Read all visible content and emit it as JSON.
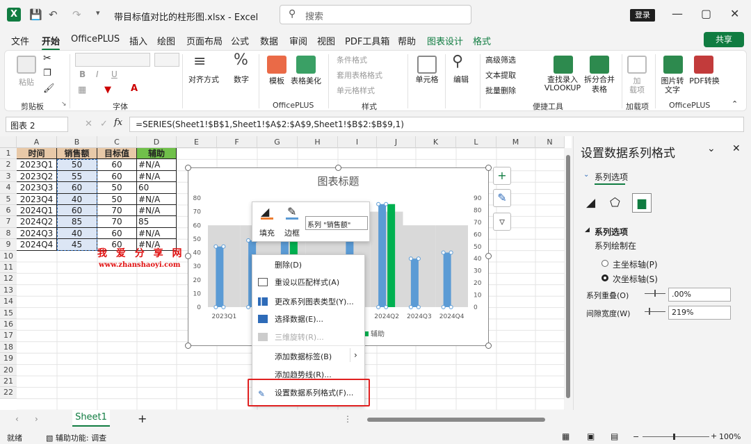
{
  "window": {
    "title": "带目标值对比的柱形图.xlsx  -  Excel",
    "search_placeholder": "搜索",
    "login_label": "登录",
    "share_label": "共享"
  },
  "menu": {
    "tabs": [
      "文件",
      "开始",
      "OfficePLUS",
      "插入",
      "绘图",
      "页面布局",
      "公式",
      "数据",
      "审阅",
      "视图",
      "PDF工具箱",
      "帮助",
      "图表设计",
      "格式"
    ],
    "active": "开始"
  },
  "ribbon": {
    "clipboard": {
      "paste": "粘贴",
      "group": "剪贴板"
    },
    "font": {
      "group": "字体",
      "bold": "B",
      "italic": "I",
      "underline": "U"
    },
    "align": {
      "label": "对齐方式"
    },
    "number": {
      "label": "数字",
      "symbol": "%"
    },
    "officeplus": {
      "template": "模板",
      "beautify": "表格美化",
      "group": "OfficePLUS"
    },
    "styles": {
      "conditional": "条件格式",
      "table_format": "套用表格格式",
      "cell_style": "单元格样式",
      "group": "样式"
    },
    "cells": {
      "label": "单元格"
    },
    "editing": {
      "label": "编辑"
    },
    "tools": {
      "filter": "高级筛选",
      "extract": "文本提取",
      "batch_delete": "批量删除",
      "lookup": "查找录入\nVLOOKUP",
      "lookup1": "查找录入",
      "lookup2": "VLOOKUP",
      "split1": "拆分合并",
      "split2": "表格",
      "group": "便捷工具"
    },
    "addins": {
      "label1": "加",
      "label2": "载项",
      "group": "加载项"
    },
    "pdf": {
      "img2txt1": "图片转",
      "img2txt2": "文字",
      "pdf_convert": "PDF转换",
      "group": "OfficePLUS"
    }
  },
  "formula_bar": {
    "name_box": "图表 2",
    "fx": "fx",
    "formula": "=SERIES(Sheet1!$B$1,Sheet1!$A$2:$A$9,Sheet1!$B$2:$B$9,1)"
  },
  "sheet": {
    "columns": [
      "A",
      "B",
      "C",
      "D",
      "E",
      "F",
      "G",
      "H",
      "I",
      "J",
      "K",
      "L",
      "M",
      "N"
    ],
    "rows": [
      "1",
      "2",
      "3",
      "4",
      "5",
      "6",
      "7",
      "8",
      "9",
      "10",
      "11",
      "12",
      "13",
      "14",
      "15",
      "16",
      "17",
      "18",
      "19",
      "20",
      "21",
      "22"
    ],
    "headers": [
      "时间",
      "销售额",
      "目标值",
      "辅助"
    ],
    "data": [
      [
        "2023Q1",
        "50",
        "60",
        "#N/A"
      ],
      [
        "2023Q2",
        "55",
        "60",
        "#N/A"
      ],
      [
        "2023Q3",
        "60",
        "50",
        "60"
      ],
      [
        "2023Q4",
        "40",
        "50",
        "#N/A"
      ],
      [
        "2024Q1",
        "60",
        "70",
        "#N/A"
      ],
      [
        "2024Q2",
        "85",
        "70",
        "85"
      ],
      [
        "2024Q3",
        "40",
        "60",
        "#N/A"
      ],
      [
        "2024Q4",
        "45",
        "60",
        "#N/A"
      ]
    ],
    "watermark1": "我 爱 分 享 网",
    "watermark2": "www.zhanshaoyi.com",
    "tab_name": "Sheet1",
    "add_sheet": "+"
  },
  "chart_data": {
    "type": "bar",
    "title": "图表标题",
    "categories": [
      "2023Q1",
      "2023Q2",
      "2023Q3",
      "2023Q4",
      "2024Q1",
      "2024Q2",
      "2024Q3",
      "2024Q4"
    ],
    "series": [
      {
        "name": "销售额",
        "values": [
          50,
          55,
          60,
          40,
          60,
          85,
          40,
          45
        ]
      },
      {
        "name": "目标值",
        "values": [
          60,
          60,
          50,
          50,
          70,
          70,
          60,
          60
        ]
      },
      {
        "name": "辅助",
        "values": [
          null,
          null,
          60,
          null,
          null,
          85,
          null,
          null
        ]
      }
    ],
    "y_left_ticks": [
      "0",
      "10",
      "20",
      "30",
      "40",
      "50",
      "60",
      "70",
      "80"
    ],
    "y_right_ticks": [
      "0",
      "10",
      "20",
      "30",
      "40",
      "50",
      "60",
      "70",
      "80",
      "90"
    ],
    "visible_xlabels": [
      "2023Q1",
      "20",
      "2024Q2",
      "2024Q3",
      "2024Q4"
    ],
    "legend_visible": "辅助",
    "colors": {
      "sales": "#5b9bd5",
      "target": "#d9d9d9",
      "helper": "#00b050"
    }
  },
  "mini_toolbar": {
    "fill": "填充",
    "border": "边框",
    "series_select": "系列 \"销售额\""
  },
  "context_menu": {
    "items": [
      "删除(D)",
      "重设以匹配样式(A)",
      "更改系列图表类型(Y)...",
      "选择数据(E)...",
      "三维旋转(R)...",
      "添加数据标签(B)",
      "添加趋势线(R)...",
      "设置数据系列格式(F)..."
    ]
  },
  "format_pane": {
    "title": "设置数据系列格式",
    "tab": "系列选项",
    "section": "系列选项",
    "plot_on": "系列绘制在",
    "primary": "主坐标轴(P)",
    "secondary": "次坐标轴(S)",
    "overlap_label": "系列重叠(O)",
    "overlap_value": ".00%",
    "gap_label": "间隙宽度(W)",
    "gap_value": "219%"
  },
  "status": {
    "ready": "就绪",
    "accessibility": "辅助功能: 调查",
    "zoom": "100%"
  }
}
